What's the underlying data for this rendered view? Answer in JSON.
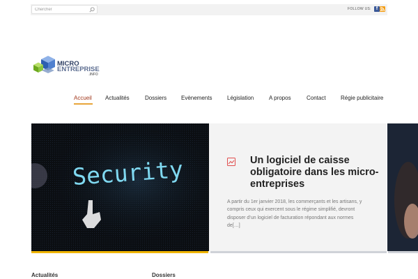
{
  "search": {
    "placeholder": "Chercher"
  },
  "follow": {
    "label": "FOLLOW US:",
    "facebook_icon": "facebook-icon",
    "rss_icon": "rss-icon"
  },
  "logo": {
    "line1": "MICRO",
    "line2": "ENTREPRISE",
    "line3": ".INFO"
  },
  "nav": {
    "items": [
      "Accueil",
      "Actualités",
      "Dossiers",
      "Evènements",
      "Législation",
      "A propos",
      "Contact",
      "Régie publicitaire"
    ],
    "active_index": 0
  },
  "hero": {
    "word": "Security"
  },
  "slide": {
    "title": "Un logiciel de caisse obligatoire dans les micro-entreprises",
    "excerpt": "A partir du 1er janvier 2018, les commerçants et les artisans, y compris ceux qui exercent sous le régime simplifié, devront disposer d’un logiciel de facturation répondant aux normes de[…]"
  },
  "sections": {
    "left": "Actualités",
    "right": "Dossiers"
  },
  "colors": {
    "accent": "#a0361b",
    "gold": "#f0b500",
    "nav_underline": "#e8a53a"
  }
}
